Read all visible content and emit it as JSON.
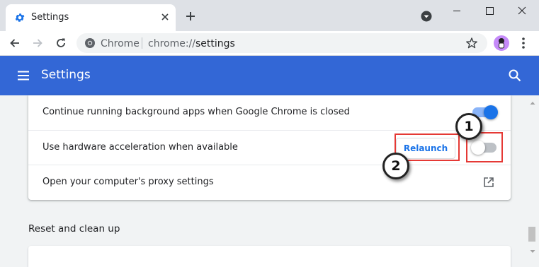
{
  "tab": {
    "title": "Settings"
  },
  "toolbar": {
    "site_name": "Chrome",
    "url_scheme": "chrome://",
    "url_path": "settings"
  },
  "header": {
    "title": "Settings"
  },
  "system": {
    "rows": [
      {
        "label": "Continue running background apps when Google Chrome is closed",
        "toggle": "on"
      },
      {
        "label": "Use hardware acceleration when available",
        "toggle": "off",
        "button": "Relaunch"
      },
      {
        "label": "Open your computer's proxy settings",
        "icon": "open-in-new-icon"
      }
    ]
  },
  "reset_section": {
    "title": "Reset and clean up"
  },
  "annotations": {
    "callout_1": "1",
    "callout_2": "2",
    "highlight_color": "#e53935"
  },
  "colors": {
    "header_bg": "#3367d6",
    "accent": "#1a73e8",
    "toggle_on_track": "#8ab4f8"
  }
}
